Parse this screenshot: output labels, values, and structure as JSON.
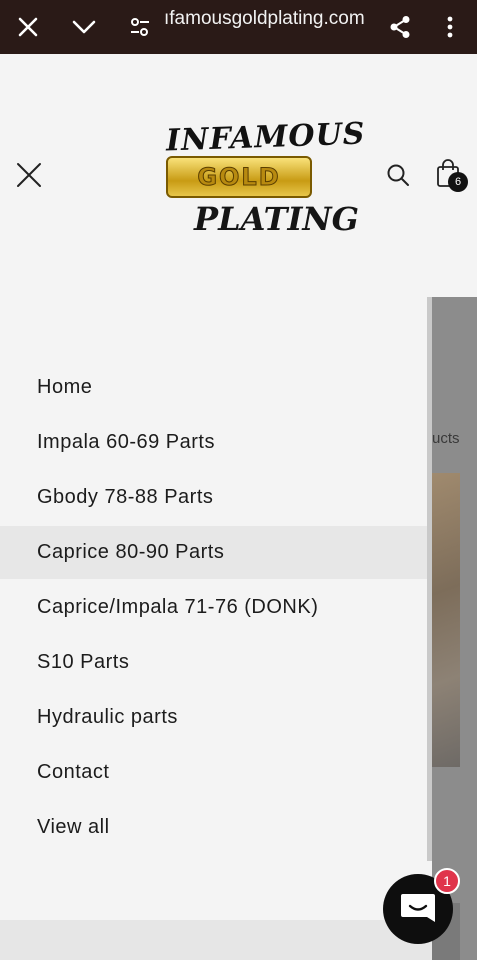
{
  "browser": {
    "url": "ıfamousgoldplating.com",
    "icons": [
      "close-icon",
      "chevron-down-icon",
      "site-settings-icon",
      "share-icon",
      "more-vert-icon"
    ]
  },
  "header": {
    "logo": {
      "line1": "INFAMOUS",
      "badge": "GOLD",
      "line3": "PLATING"
    },
    "cart_count": "6"
  },
  "menu": {
    "items": [
      {
        "label": "Home",
        "active": false
      },
      {
        "label": "Impala 60-69 Parts",
        "active": false
      },
      {
        "label": "Gbody 78-88 Parts",
        "active": false
      },
      {
        "label": "Caprice 80-90 Parts",
        "active": true
      },
      {
        "label": "Caprice/Impala 71-76 (DONK)",
        "active": false
      },
      {
        "label": "S10 Parts",
        "active": false
      },
      {
        "label": "Hydraulic parts",
        "active": false
      },
      {
        "label": "Contact",
        "active": false
      },
      {
        "label": "View all",
        "active": false
      }
    ]
  },
  "background_page": {
    "partial_text": "ucts"
  },
  "chat": {
    "badge_count": "1"
  },
  "colors": {
    "browser_bar": "#2a1a17",
    "drawer_bg": "#f4f4f4",
    "active_item": "#e7e7e7",
    "chat_badge": "#e0344b"
  }
}
